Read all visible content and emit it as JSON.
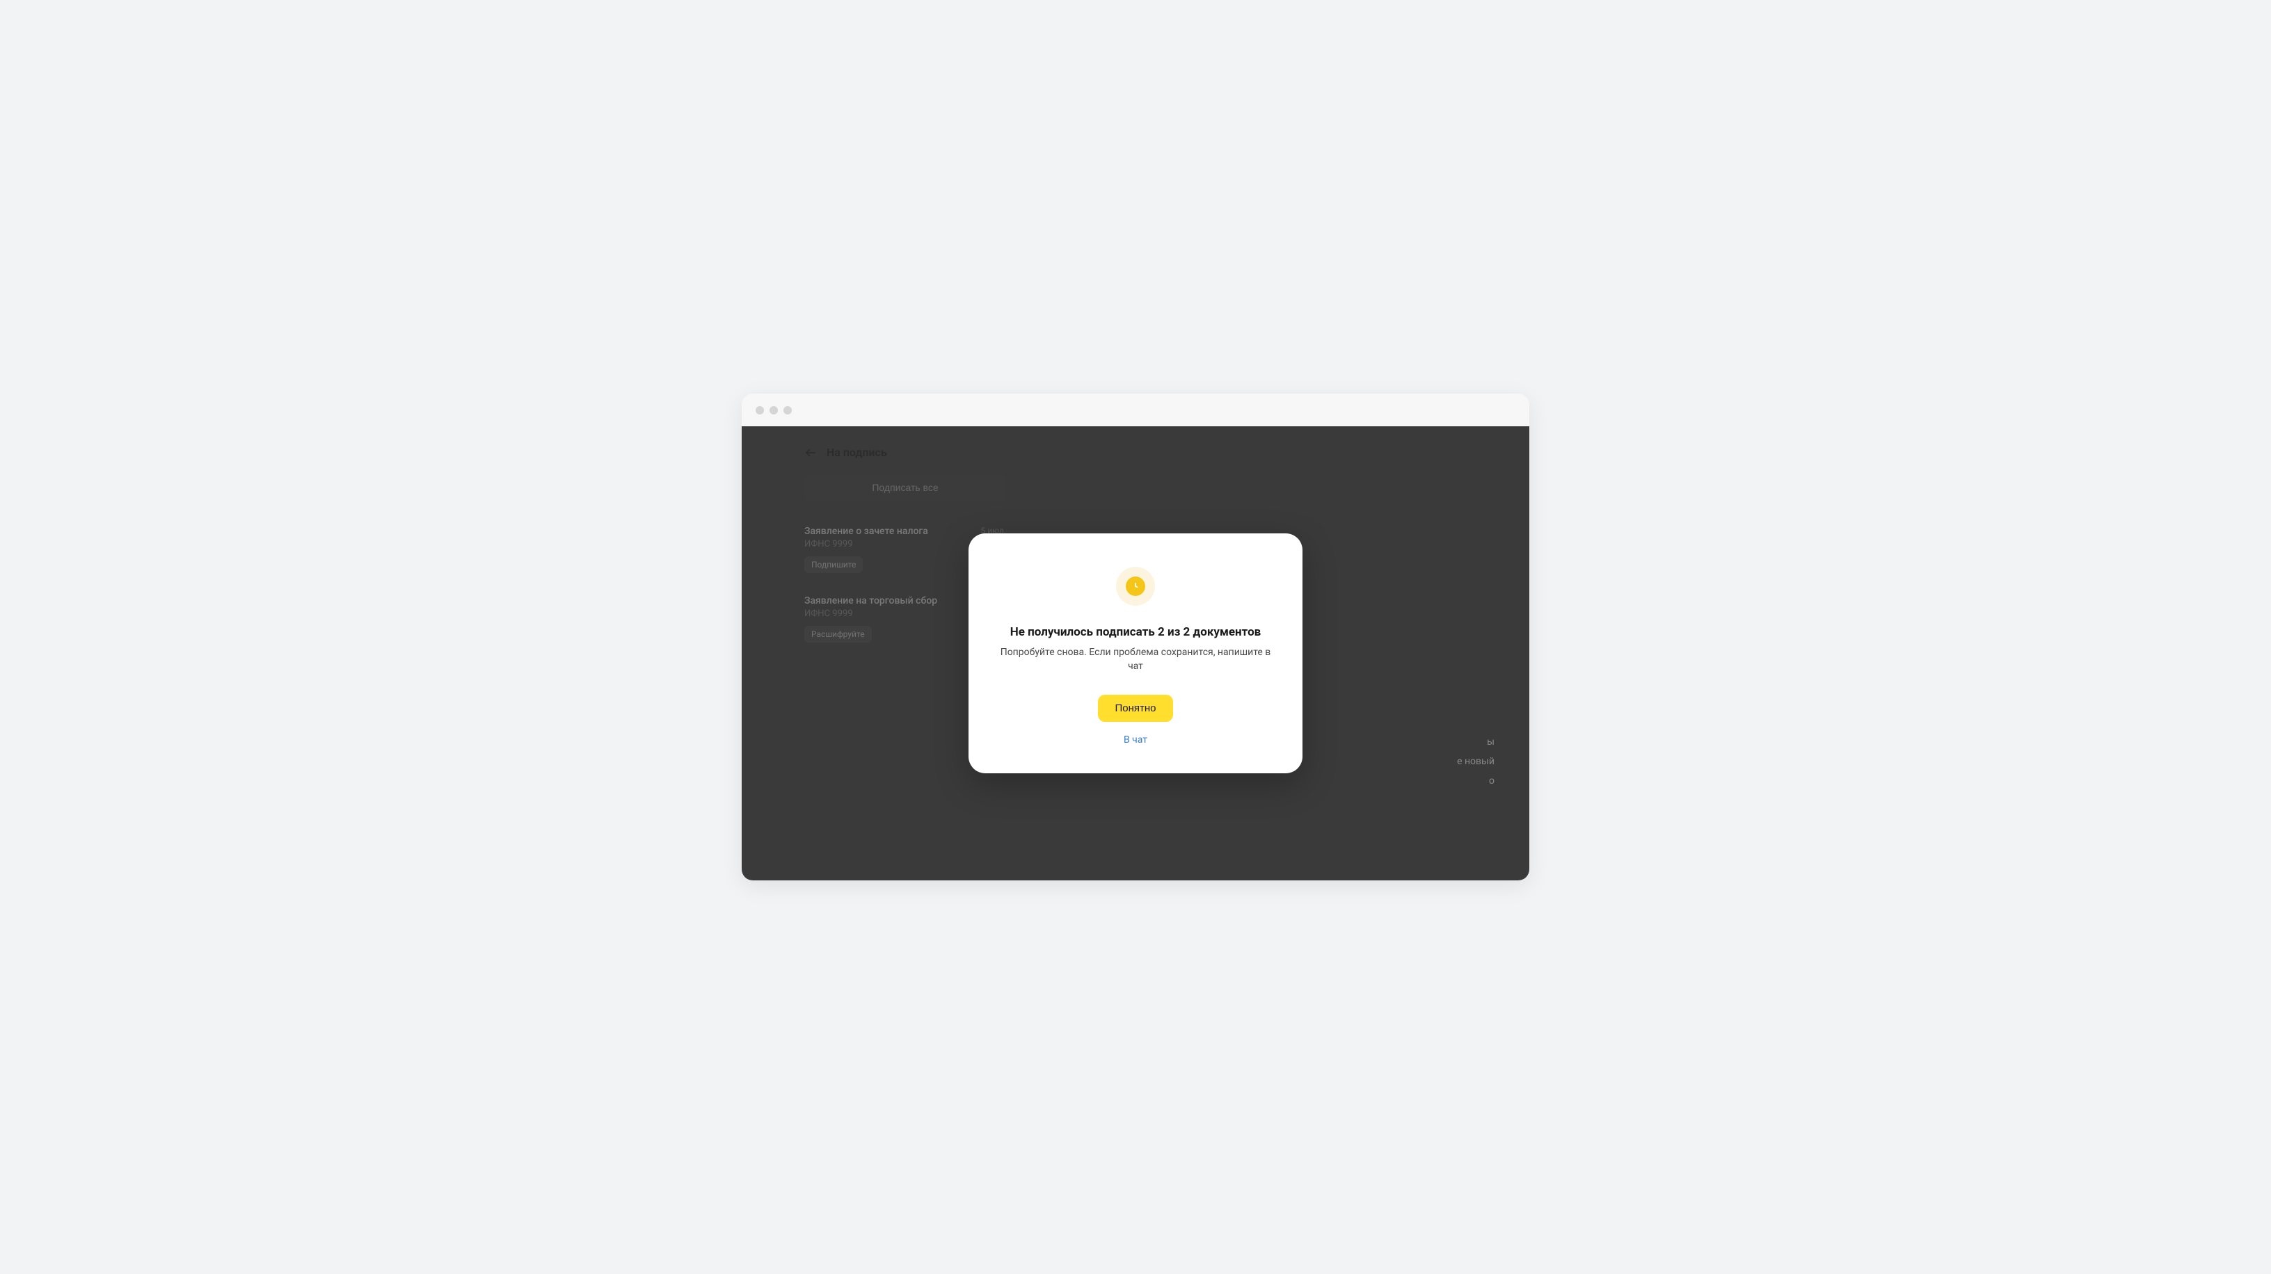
{
  "page": {
    "title": "На подпись",
    "sign_all_label": "Подписать все"
  },
  "documents": [
    {
      "title": "Заявление о зачете налога",
      "org": "ИФНС 9999",
      "date": "5 июл.",
      "chip": "Подпишите"
    },
    {
      "title": "Заявление на торговый сбор",
      "org": "ИФНС 9999",
      "date": "",
      "chip": "Расшифруйте"
    }
  ],
  "modal": {
    "title": "Не получилось подписать 2 из 2 документов",
    "text": "Попробуйте снова. Если проблема сохранится, напишите в чат",
    "primary_label": "Понятно",
    "link_label": "В чат"
  },
  "background_hints": {
    "line1": "ы",
    "line2": "е новый",
    "line3": "о"
  },
  "colors": {
    "accent_yellow": "#ffde2e",
    "icon_yellow": "#f5c518",
    "link_blue": "#3a7cc8"
  }
}
